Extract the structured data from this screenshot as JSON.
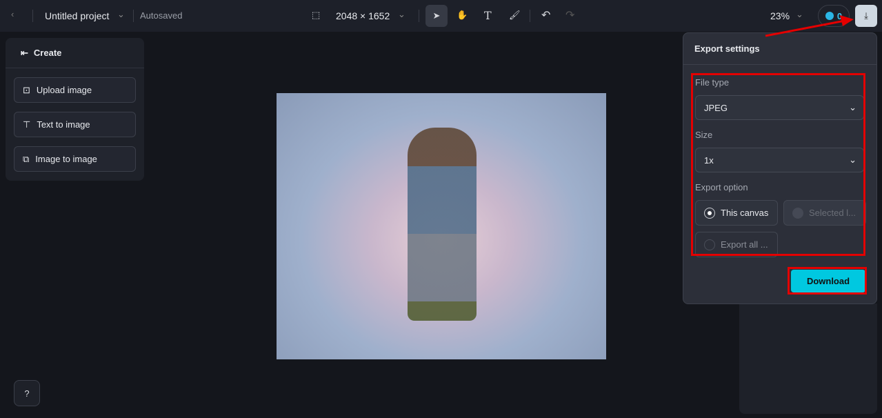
{
  "topbar": {
    "project_title": "Untitled project",
    "save_status": "Autosaved",
    "canvas_size": "2048 × 1652",
    "zoom": "23%",
    "credits": "0"
  },
  "create_panel": {
    "title": "Create",
    "items": [
      {
        "label": "Upload image",
        "icon": "upload-image-icon"
      },
      {
        "label": "Text to image",
        "icon": "text-to-image-icon"
      },
      {
        "label": "Image to image",
        "icon": "image-to-image-icon"
      }
    ]
  },
  "export": {
    "title": "Export settings",
    "file_type_label": "File type",
    "file_type": "JPEG",
    "size_label": "Size",
    "size": "1x",
    "export_option_label": "Export option",
    "options": [
      {
        "label": "This canvas",
        "selected": true,
        "enabled": true
      },
      {
        "label": "Selected l...",
        "selected": false,
        "enabled": false
      },
      {
        "label": "Export all ...",
        "selected": false,
        "enabled": false
      }
    ],
    "download_label": "Download"
  },
  "colors": {
    "accent": "#00c8e0",
    "annotation": "#e40000"
  }
}
